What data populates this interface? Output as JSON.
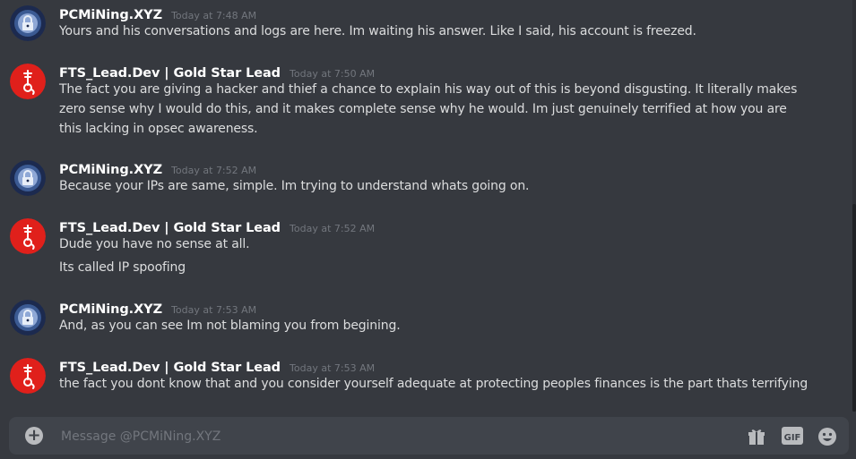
{
  "messages": [
    {
      "author": "PCMiNing.XYZ",
      "avatar": "lock-icon",
      "timestamp": "Today at 7:48 AM",
      "lines": [
        "Yours and his conversations and logs are here. Im waiting his answer. Like I said, his account is freezed."
      ]
    },
    {
      "author": "FTS_Lead.Dev | Gold Star Lead",
      "avatar": "glyph-icon",
      "timestamp": "Today at 7:50 AM",
      "lines": [
        "The fact you are giving a hacker and thief a chance to explain his way out of this is beyond disgusting. It literally makes zero sense why I would do this, and it makes complete sense why he would. Im just genuinely terrified at how you are this lacking in opsec awareness."
      ]
    },
    {
      "author": "PCMiNing.XYZ",
      "avatar": "lock-icon",
      "timestamp": "Today at 7:52 AM",
      "lines": [
        "Because your IPs are same, simple. Im trying to understand whats going on."
      ]
    },
    {
      "author": "FTS_Lead.Dev | Gold Star Lead",
      "avatar": "glyph-icon",
      "timestamp": "Today at 7:52 AM",
      "lines": [
        "Dude you have no sense at all.",
        "Its called IP spoofing"
      ]
    },
    {
      "author": "PCMiNing.XYZ",
      "avatar": "lock-icon",
      "timestamp": "Today at 7:53 AM",
      "lines": [
        "And, as you can see Im not blaming you from begining."
      ]
    },
    {
      "author": "FTS_Lead.Dev | Gold Star Lead",
      "avatar": "glyph-icon",
      "timestamp": "Today at 7:53 AM",
      "lines": [
        "the fact you dont know that and you consider yourself adequate at protecting peoples finances is the part thats terrifying"
      ]
    }
  ],
  "composer": {
    "placeholder": "Message @PCMiNing.XYZ",
    "add_icon": "plus-circle-icon",
    "gift_icon": "gift-icon",
    "gif_label": "GIF",
    "emoji_icon": "emoji-icon"
  },
  "colors": {
    "background": "#36393f",
    "composer": "#40444b",
    "username": "#ffffff",
    "timestamp": "#72767d",
    "text": "#dcddde",
    "glyph_avatar": "#e0201b",
    "lock_avatar": "#2b3d6e"
  }
}
